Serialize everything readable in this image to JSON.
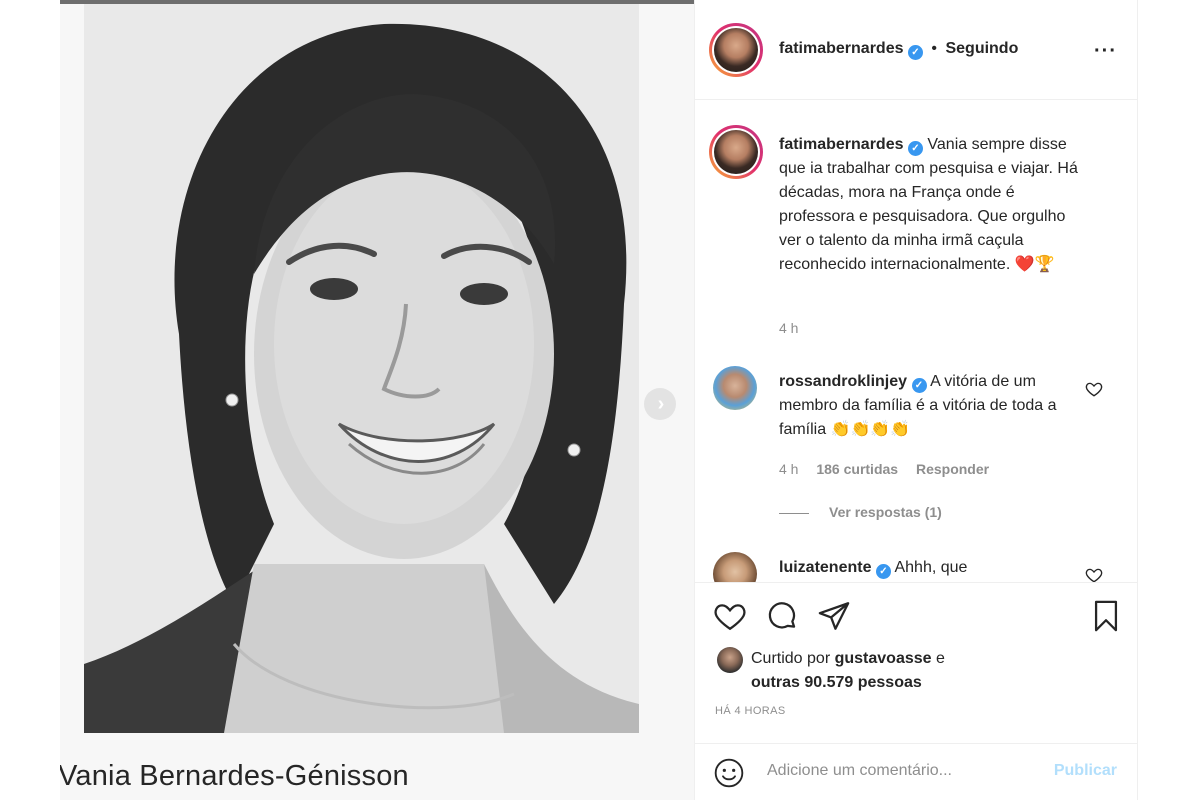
{
  "post": {
    "caption_overlay": "Vania Bernardes-Génisson"
  },
  "header": {
    "username": "fatimabernardes",
    "separator": "•",
    "follow_status": "Seguindo",
    "more_icon": "more-horizontal-icon"
  },
  "caption": {
    "username": "fatimabernardes",
    "text": "Vania sempre disse que ia trabalhar com pesquisa e viajar. Há décadas, mora na França onde é professora e pesquisadora. Que orgulho ver o talento da minha irmã caçula reconhecido internacionalmente. ❤️🏆",
    "time": "4 h"
  },
  "comments": [
    {
      "username": "rossandroklinjey",
      "text": "A vitória de um membro da família é a vitória de toda a família 👏👏👏👏",
      "time": "4 h",
      "likes": "186 curtidas",
      "reply_label": "Responder",
      "view_replies": "Ver respostas (1)"
    },
    {
      "username": "luizatenente",
      "text": "Ahhh, que"
    }
  ],
  "actions": {
    "liked_prefix": "Curtido por",
    "liked_user": "gustavoasse",
    "liked_and": "e",
    "liked_others": "outras 90.579 pessoas",
    "time_ago": "HÁ 4 HORAS"
  },
  "add_comment": {
    "placeholder": "Adicione um comentário...",
    "publish_label": "Publicar"
  },
  "colors": {
    "verified": "#3897f0",
    "publish_disabled": "#b2dffc",
    "secondary_text": "#8e8e8e"
  }
}
